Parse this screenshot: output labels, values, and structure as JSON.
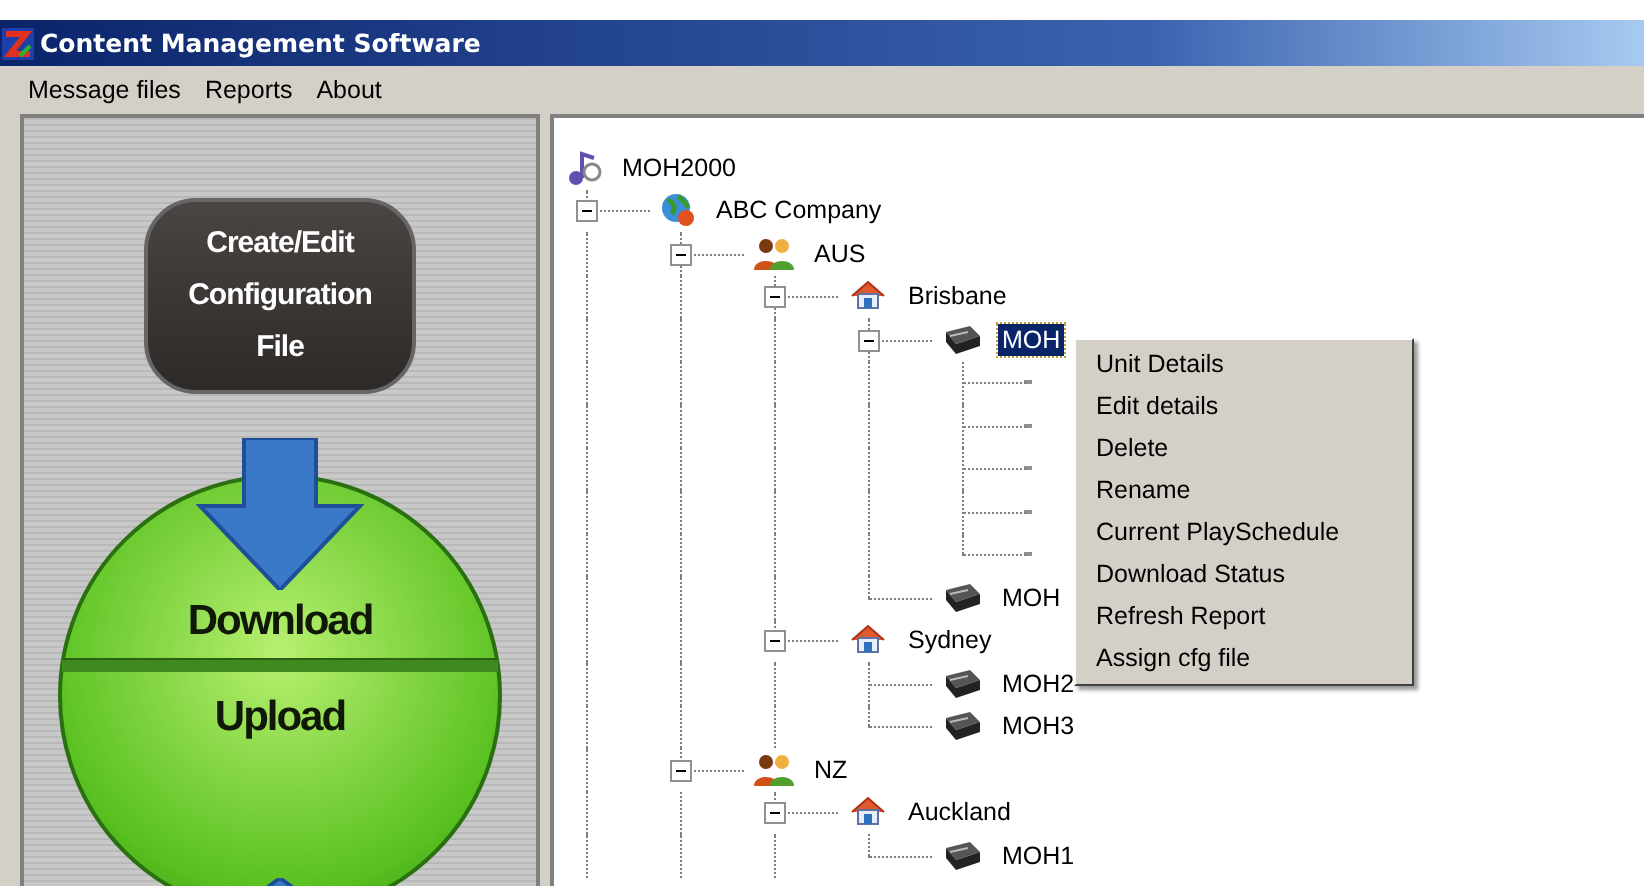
{
  "window": {
    "title": "Content Management Software"
  },
  "menu_bar": [
    "Message files",
    "Reports",
    "About"
  ],
  "side_panel": {
    "config_button": "Create/Edit Configuration File",
    "download_button": "Download",
    "upload_button": "Upload"
  },
  "tree": {
    "label": "MOH2000",
    "kind": "root",
    "selected": false,
    "children": [
      {
        "label": "ABC Company",
        "kind": "company",
        "expanded": true,
        "selected": false,
        "children": [
          {
            "label": "AUS",
            "kind": "group",
            "expanded": true,
            "selected": false,
            "children": [
              {
                "label": "Brisbane",
                "kind": "site",
                "expanded": true,
                "selected": false,
                "children": [
                  {
                    "label": "MOH",
                    "kind": "device",
                    "expanded": true,
                    "selected": true,
                    "children": [
                      {
                        "kind": "covered"
                      },
                      {
                        "kind": "covered"
                      },
                      {
                        "kind": "covered"
                      },
                      {
                        "kind": "covered"
                      },
                      {
                        "kind": "covered"
                      }
                    ]
                  },
                  {
                    "label": "MOH",
                    "kind": "device",
                    "selected": false
                  }
                ]
              },
              {
                "label": "Sydney",
                "kind": "site",
                "expanded": true,
                "selected": false,
                "children": [
                  {
                    "label": "MOH2",
                    "kind": "device",
                    "selected": false
                  },
                  {
                    "label": "MOH3",
                    "kind": "device",
                    "selected": false
                  }
                ]
              }
            ]
          },
          {
            "label": "NZ",
            "kind": "group",
            "expanded": true,
            "selected": false,
            "children": [
              {
                "label": "Auckland",
                "kind": "site",
                "expanded": true,
                "selected": false,
                "children": [
                  {
                    "label": "MOH1",
                    "kind": "device",
                    "selected": false
                  }
                ]
              }
            ]
          }
        ]
      }
    ]
  },
  "context_menu": [
    "Unit Details",
    "Edit details",
    "Delete",
    "Rename",
    "Current PlaySchedule",
    "Download Status",
    "Refresh Report",
    "Assign cfg file"
  ]
}
